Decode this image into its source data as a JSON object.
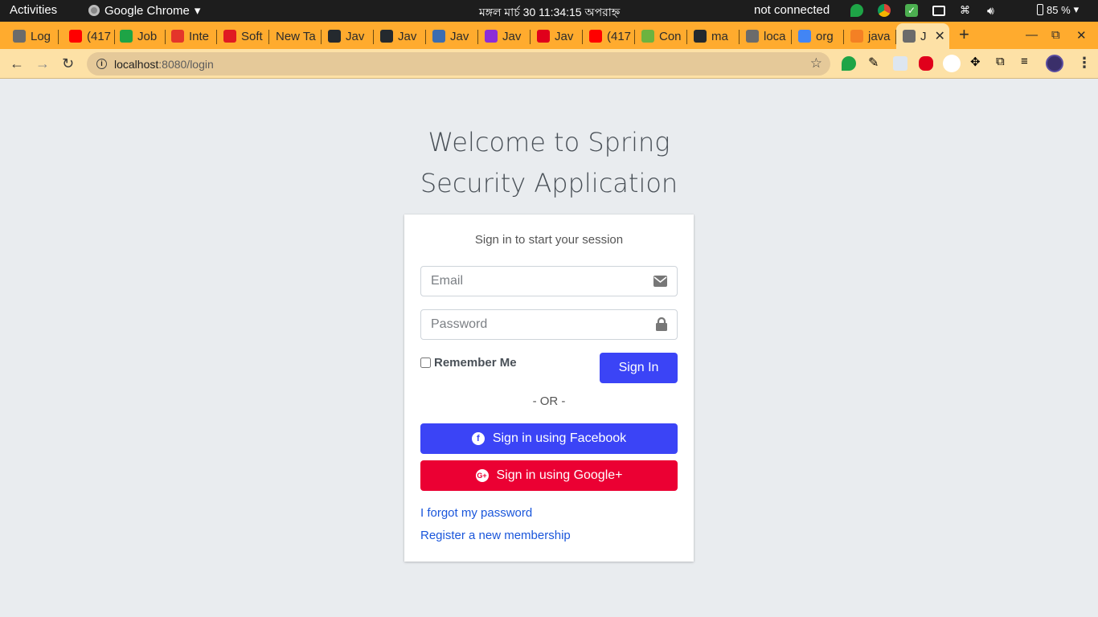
{
  "os_bar": {
    "activities": "Activities",
    "app_name": "Google Chrome",
    "clock": "মঙ্গল মার্চ 30  11:34:15 অপরাহ্ন",
    "network": "not connected",
    "battery": "85 %"
  },
  "tabs": [
    {
      "title": "Log",
      "favicon_color": "#6b6b6b",
      "favicon": "globe-icon"
    },
    {
      "title": "(417",
      "favicon_color": "#ff0000",
      "favicon": "youtube-icon"
    },
    {
      "title": "Job",
      "favicon_color": "#1ea446",
      "favicon": "plus-icon"
    },
    {
      "title": "Inte",
      "favicon_color": "#e4352a",
      "favicon": "slash-icon"
    },
    {
      "title": "Soft",
      "favicon_color": "#e01a22",
      "favicon": "j-icon"
    },
    {
      "title": "New Ta",
      "favicon_color": "",
      "favicon": ""
    },
    {
      "title": "Jav",
      "favicon_color": "#24292e",
      "favicon": "github-icon"
    },
    {
      "title": "Jav",
      "favicon_color": "#24292e",
      "favicon": "github-icon"
    },
    {
      "title": "Jav",
      "favicon_color": "#3c6db0",
      "favicon": "java-icon"
    },
    {
      "title": "Jav",
      "favicon_color": "#8c2dd8",
      "favicon": "d-icon"
    },
    {
      "title": "Jav",
      "favicon_color": "#e0001b",
      "favicon": "oracle-icon"
    },
    {
      "title": "(417",
      "favicon_color": "#ff0000",
      "favicon": "youtube-icon"
    },
    {
      "title": "Con",
      "favicon_color": "#6db33f",
      "favicon": "spring-icon"
    },
    {
      "title": "ma",
      "favicon_color": "#24292e",
      "favicon": "github-icon"
    },
    {
      "title": "loca",
      "favicon_color": "#6b6b6b",
      "favicon": "globe-icon"
    },
    {
      "title": "org",
      "favicon_color": "#4285f4",
      "favicon": "google-icon"
    },
    {
      "title": "java",
      "favicon_color": "#f48024",
      "favicon": "stackoverflow-icon"
    },
    {
      "title": "J",
      "favicon_color": "#6b6b6b",
      "favicon": "globe-icon",
      "active": true
    }
  ],
  "address_bar": {
    "host": "localhost",
    "rest": ":8080/login"
  },
  "page": {
    "title_line1": "Welcome to Spring",
    "title_line2": "Security Application",
    "message": "Sign in to start your session",
    "email_placeholder": "Email",
    "password_placeholder": "Password",
    "remember_label": "Remember Me",
    "signin_label": "Sign In",
    "or_label": "- OR -",
    "facebook_label": "Sign in using Facebook",
    "google_label": "Sign in using Google+",
    "forgot_link": "I forgot my password",
    "register_link": "Register a new membership"
  },
  "colors": {
    "primary": "#3b44f6",
    "google": "#eb0033",
    "link": "#1a56db",
    "chrome_frame": "#ffab2e",
    "chrome_toolbar": "#fde1a6"
  }
}
